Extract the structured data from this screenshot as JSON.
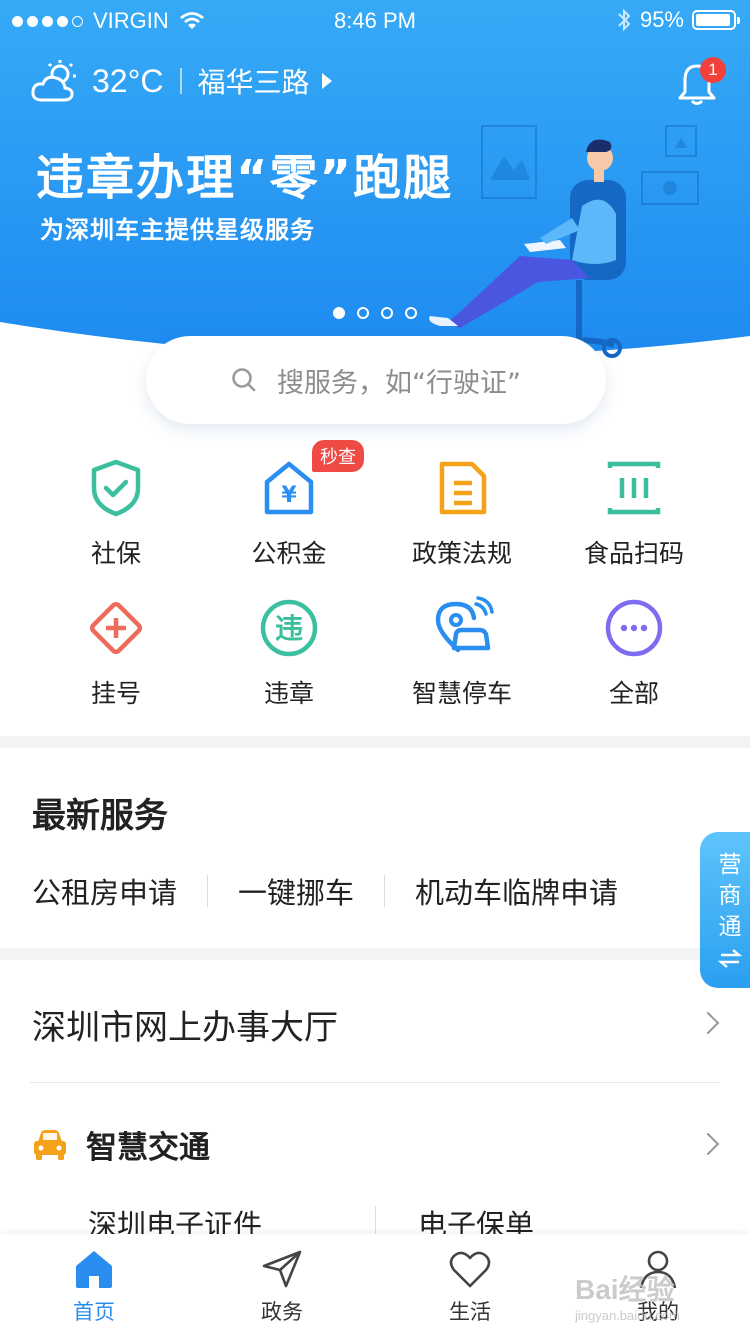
{
  "status_bar": {
    "carrier": "VIRGIN",
    "time": "8:46 PM",
    "battery": "95%",
    "battery_level": 0.95,
    "signal_bars": 4,
    "signal_total": 5
  },
  "header": {
    "temperature": "32°C",
    "location": "福华三路",
    "notification_count": "1"
  },
  "banner": {
    "headline": "违章办理“零”跑腿",
    "subline": "为深圳车主提供星级服务",
    "slide_count": 4,
    "active_slide": 0
  },
  "search": {
    "placeholder": "搜服务，如“行驶证”"
  },
  "services": [
    {
      "label": "社保",
      "icon": "shield-check-icon"
    },
    {
      "label": "公积金",
      "icon": "house-yuan-icon",
      "badge": "秒查"
    },
    {
      "label": "政策法规",
      "icon": "document-icon"
    },
    {
      "label": "食品扫码",
      "icon": "barcode-scan-icon"
    },
    {
      "label": "挂号",
      "icon": "medical-cross-icon"
    },
    {
      "label": "违章",
      "icon": "violation-icon",
      "glyph": "违"
    },
    {
      "label": "智慧停车",
      "icon": "smart-parking-icon"
    },
    {
      "label": "全部",
      "icon": "more-icon"
    }
  ],
  "latest": {
    "title": "最新服务",
    "items": [
      "公租房申请",
      "一键挪车",
      "机动车临牌申请"
    ]
  },
  "hall": {
    "title": "深圳市网上办事大厅"
  },
  "traffic": {
    "title": "智慧交通",
    "items": [
      "深圳电子证件",
      "电子保单"
    ]
  },
  "float_tab": {
    "label": "营商通"
  },
  "tabs": [
    {
      "label": "首页",
      "icon": "home-icon",
      "active": true
    },
    {
      "label": "政务",
      "icon": "send-icon",
      "active": false
    },
    {
      "label": "生活",
      "icon": "heart-icon",
      "active": false
    },
    {
      "label": "我的",
      "icon": "user-icon",
      "active": false
    }
  ],
  "watermark": {
    "brand": "Bai",
    "brand_suffix": "经验",
    "url": "jingyan.baidu.com"
  },
  "colors": {
    "banner_top": "#2fa3f3",
    "banner_bottom": "#1f8cf0",
    "accent_blue": "#2a8ef0",
    "badge_red": "#f04a45",
    "teal": "#3cbf9e",
    "orange": "#f5a21b",
    "purple": "#7e6cf0",
    "coral": "#ef6b5b"
  }
}
